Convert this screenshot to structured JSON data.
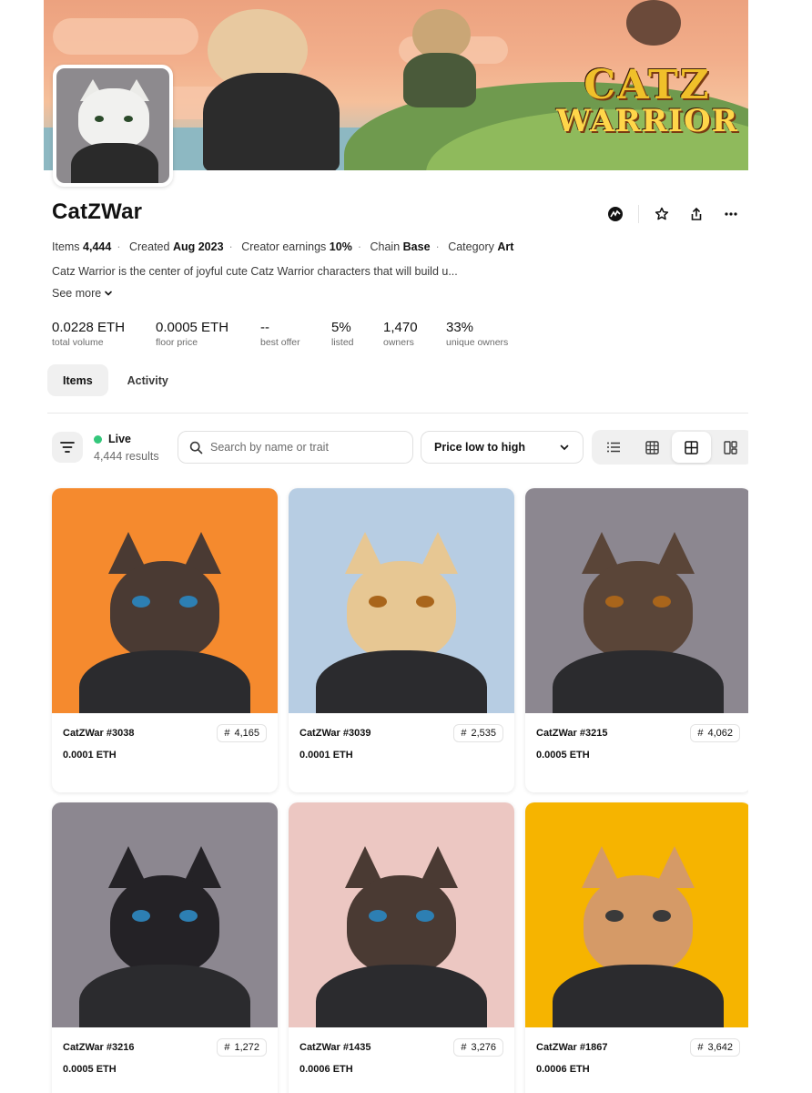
{
  "collection": {
    "name": "CatZWar",
    "banner_logo_line1": "CATZ",
    "banner_logo_line2": "WARRIOR",
    "meta": {
      "items_label": "Items",
      "items_value": "4,444",
      "created_label": "Created",
      "created_value": "Aug 2023",
      "earnings_label": "Creator earnings",
      "earnings_value": "10%",
      "chain_label": "Chain",
      "chain_value": "Base",
      "category_label": "Category",
      "category_value": "Art"
    },
    "description": "Catz Warrior is the center of joyful cute Catz Warrior characters that will build u...",
    "see_more": "See more"
  },
  "stats": [
    {
      "value": "0.0228 ETH",
      "label": "total volume"
    },
    {
      "value": "0.0005 ETH",
      "label": "floor price"
    },
    {
      "value": "--",
      "label": "best offer"
    },
    {
      "value": "5%",
      "label": "listed"
    },
    {
      "value": "1,470",
      "label": "owners"
    },
    {
      "value": "33%",
      "label": "unique owners"
    }
  ],
  "tabs": [
    {
      "label": "Items",
      "active": true
    },
    {
      "label": "Activity",
      "active": false
    }
  ],
  "toolbar": {
    "status": "Live",
    "results": "4,444 results",
    "search_placeholder": "Search by name or trait",
    "sort_value": "Price low to high"
  },
  "items": [
    {
      "name": "CatZWar #3038",
      "rank": "4,165",
      "price": "0.0001 ETH",
      "bg": "#f58a2e",
      "fur": "#4a3a33",
      "eye": "#2d7fb3"
    },
    {
      "name": "CatZWar #3039",
      "rank": "2,535",
      "price": "0.0001 ETH",
      "bg": "#b7cde3",
      "fur": "#e7c793",
      "eye": "#a9651b"
    },
    {
      "name": "CatZWar #3215",
      "rank": "4,062",
      "price": "0.0005 ETH",
      "bg": "#8c8790",
      "fur": "#5a4538",
      "eye": "#a9651b"
    },
    {
      "name": "CatZWar #3216",
      "rank": "1,272",
      "price": "0.0005 ETH",
      "bg": "#8c8790",
      "fur": "#242226",
      "eye": "#2d7fb3"
    },
    {
      "name": "CatZWar #1435",
      "rank": "3,276",
      "price": "0.0006 ETH",
      "bg": "#ecc7c2",
      "fur": "#4a3a33",
      "eye": "#2d7fb3"
    },
    {
      "name": "CatZWar #1867",
      "rank": "3,642",
      "price": "0.0006 ETH",
      "bg": "#f6b400",
      "fur": "#d59a67",
      "eye": "#3a3a3a"
    }
  ],
  "colors": {
    "live_dot": "#34c77b",
    "surface": "#f0f0f0",
    "text": "#121212",
    "muted": "#6b6b6b"
  }
}
